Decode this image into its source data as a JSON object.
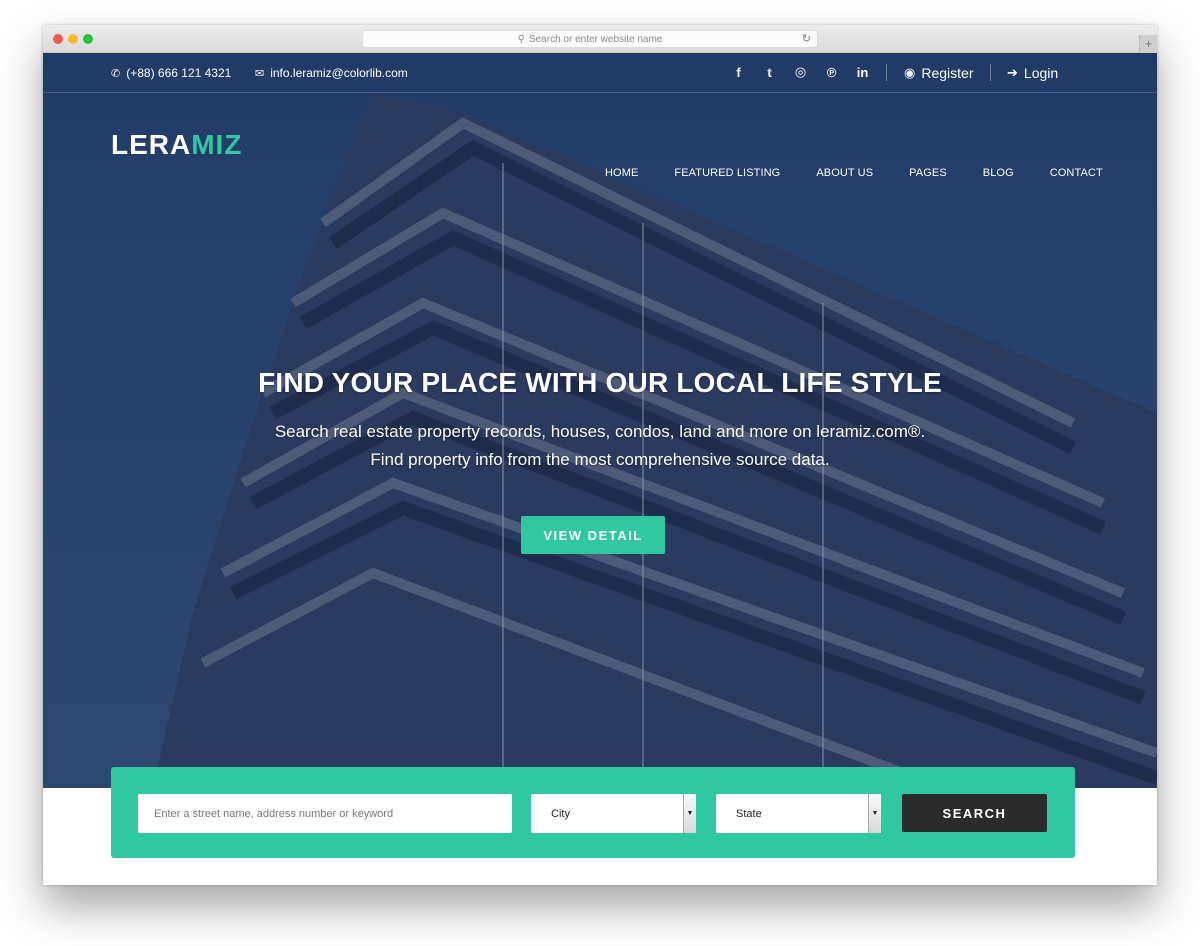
{
  "browser": {
    "address_placeholder": "Search or enter website name",
    "icons": {
      "search": "magnifier-icon",
      "reload": "reload-icon",
      "new_tab": "plus-icon"
    },
    "reload_glyph": "↻",
    "new_tab_glyph": "+",
    "search_glyph": "⚲"
  },
  "topbar": {
    "phone": "(+88) 666 121 4321",
    "phone_glyph": "✆",
    "email": "info.leramiz@colorlib.com",
    "email_glyph": "✉",
    "social": [
      {
        "name": "facebook",
        "glyph": "f"
      },
      {
        "name": "twitter",
        "glyph": "t"
      },
      {
        "name": "instagram",
        "glyph": "◎"
      },
      {
        "name": "pinterest",
        "glyph": "℗"
      },
      {
        "name": "linkedin",
        "glyph": "in"
      }
    ],
    "register_label": "Register",
    "register_glyph": "◉",
    "login_label": "Login",
    "login_glyph": "➔"
  },
  "brand": {
    "logo_main": "LERA",
    "logo_accent": "MIZ",
    "accent_color": "#30c8a0"
  },
  "nav": [
    "HOME",
    "FEATURED LISTING",
    "ABOUT US",
    "PAGES",
    "BLOG",
    "CONTACT"
  ],
  "hero": {
    "headline": "FIND YOUR PLACE WITH OUR LOCAL LIFE STYLE",
    "sub_line1": "Search real estate property records, houses, condos, land and more on leramiz.com®.",
    "sub_line2": "Find property info from the most comprehensive source data.",
    "cta_label": "VIEW DETAIL"
  },
  "search": {
    "keyword_placeholder": "Enter a street name, address number or keyword",
    "city_selected": "City",
    "state_selected": "State",
    "dropdown_glyph": "▼",
    "button_label": "SEARCH"
  }
}
